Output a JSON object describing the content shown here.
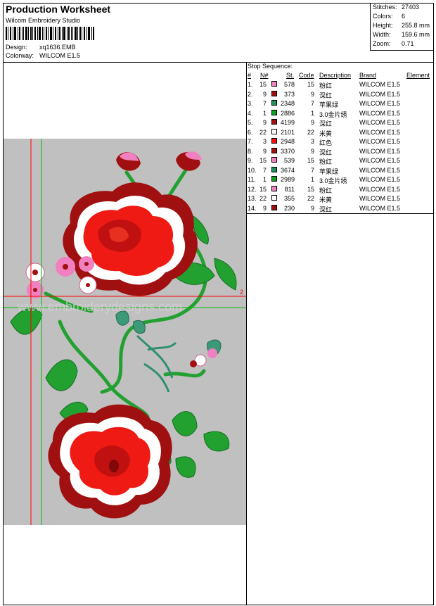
{
  "header": {
    "title": "Production Worksheet",
    "studio": "Wilcom Embroidery Studio",
    "design_label": "Design:",
    "design_value": "xq1636.EMB",
    "colorway_label": "Colorway:",
    "colorway_value": "WILCOM E1.5"
  },
  "stats": {
    "stitches_label": "Stitches:",
    "stitches_value": "27403",
    "colors_label": "Colors:",
    "colors_value": "6",
    "height_label": "Height:",
    "height_value": "255.8 mm",
    "width_label": "Width:",
    "width_value": "159.6 mm",
    "zoom_label": "Zoom:",
    "zoom_value": "0.71"
  },
  "preview": {
    "marker_label": "2",
    "watermark": "www.embroiderydesigns.com"
  },
  "sequence": {
    "title": "Stop Sequence:",
    "headers": {
      "idx": "#",
      "n": "N#",
      "st": "St.",
      "code": "Code",
      "desc": "Description",
      "brand": "Brand",
      "element": "Element"
    },
    "rows": [
      {
        "idx": "1.",
        "n": "15",
        "color": "#f080c0",
        "st": "578",
        "code": "15",
        "desc": "粉红",
        "brand": "WILCOM E1.5"
      },
      {
        "idx": "2.",
        "n": "9",
        "color": "#a01010",
        "st": "373",
        "code": "9",
        "desc": "深红",
        "brand": "WILCOM E1.5"
      },
      {
        "idx": "3.",
        "n": "7",
        "color": "#209060",
        "st": "2348",
        "code": "7",
        "desc": "苹果绿",
        "brand": "WILCOM E1.5"
      },
      {
        "idx": "4.",
        "n": "1",
        "color": "#10a020",
        "st": "2886",
        "code": "1",
        "desc": "3.0金片绣",
        "brand": "WILCOM E1.5"
      },
      {
        "idx": "5.",
        "n": "9",
        "color": "#a01010",
        "st": "4199",
        "code": "9",
        "desc": "深红",
        "brand": "WILCOM E1.5"
      },
      {
        "idx": "6.",
        "n": "22",
        "color": "#ffffff",
        "st": "2101",
        "code": "22",
        "desc": "米黄",
        "brand": "WILCOM E1.5"
      },
      {
        "idx": "7.",
        "n": "3",
        "color": "#f01010",
        "st": "2948",
        "code": "3",
        "desc": "红色",
        "brand": "WILCOM E1.5"
      },
      {
        "idx": "8.",
        "n": "9",
        "color": "#a01010",
        "st": "3370",
        "code": "9",
        "desc": "深红",
        "brand": "WILCOM E1.5"
      },
      {
        "idx": "9.",
        "n": "15",
        "color": "#f080c0",
        "st": "539",
        "code": "15",
        "desc": "粉红",
        "brand": "WILCOM E1.5"
      },
      {
        "idx": "10.",
        "n": "7",
        "color": "#209060",
        "st": "3674",
        "code": "7",
        "desc": "苹果绿",
        "brand": "WILCOM E1.5"
      },
      {
        "idx": "11.",
        "n": "1",
        "color": "#10a020",
        "st": "2989",
        "code": "1",
        "desc": "3.0金片绣",
        "brand": "WILCOM E1.5"
      },
      {
        "idx": "12.",
        "n": "15",
        "color": "#f080c0",
        "st": "811",
        "code": "15",
        "desc": "粉红",
        "brand": "WILCOM E1.5"
      },
      {
        "idx": "13.",
        "n": "22",
        "color": "#ffffff",
        "st": "355",
        "code": "22",
        "desc": "米黄",
        "brand": "WILCOM E1.5"
      },
      {
        "idx": "14.",
        "n": "9",
        "color": "#a01010",
        "st": "230",
        "code": "9",
        "desc": "深红",
        "brand": "WILCOM E1.5"
      }
    ]
  }
}
